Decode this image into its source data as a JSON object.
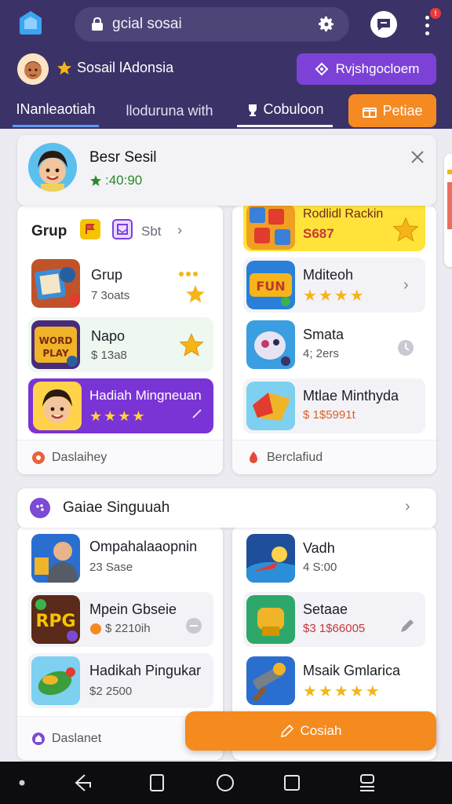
{
  "header": {
    "search": {
      "value": "gcial sosai",
      "icon": "lock-icon"
    },
    "settings_icon": "gear-icon",
    "notification_badge": "!",
    "brand_name": "Sosail lAdonsia",
    "promo_button_label": "Rvjshgocloem",
    "tabs": [
      {
        "label": "INanleaotiah"
      },
      {
        "label": "lloduruna with"
      },
      {
        "label": "Cobuloon"
      },
      {
        "label": "Petiae"
      }
    ]
  },
  "profile": {
    "name": "Besr Sesil",
    "points": ":40:90"
  },
  "group_panel": {
    "title": "Grup",
    "sort_label": "Sbt",
    "items": [
      {
        "name": "Grup",
        "sub": "7 3oats"
      },
      {
        "name": "Napo",
        "sub": "$ 13a8"
      },
      {
        "name": "Hadiah Mingneuan",
        "sub": "★★★★"
      }
    ],
    "footer": "Daslaihey"
  },
  "right_panel": {
    "items": [
      {
        "name": "Rodlidl Rackin",
        "sub": "S687"
      },
      {
        "name": "Mditeoh",
        "sub": "★★★★"
      },
      {
        "name": "Smata",
        "sub": "4; 2ers"
      },
      {
        "name": "Mtlae Minthyda",
        "sub": "$ 1$5991t"
      }
    ],
    "footer": "Berclafiud"
  },
  "section": {
    "title": "Gaiae Singuuah"
  },
  "left_panel2": {
    "items": [
      {
        "name": "Ompahalaaopnin",
        "sub": "23 Sase"
      },
      {
        "name": "Mpein Gbseie",
        "sub": "$ 2210ih"
      },
      {
        "name": "Hadikah Pingukar",
        "sub": "$2 2500"
      }
    ],
    "footer": "Daslanet"
  },
  "right_panel2": {
    "items": [
      {
        "name": "Vadh",
        "sub": "4 S:00"
      },
      {
        "name": "Setaae",
        "sub": "$3 1$66005"
      },
      {
        "name": "Msaik Gmlarica",
        "sub": "★★★★★"
      }
    ]
  },
  "fab_label": "Cosiah",
  "colors": {
    "header_bg": "#3b3268",
    "accent_purple": "#7c42d8",
    "accent_orange": "#f58a22",
    "star": "#f5b51a"
  }
}
